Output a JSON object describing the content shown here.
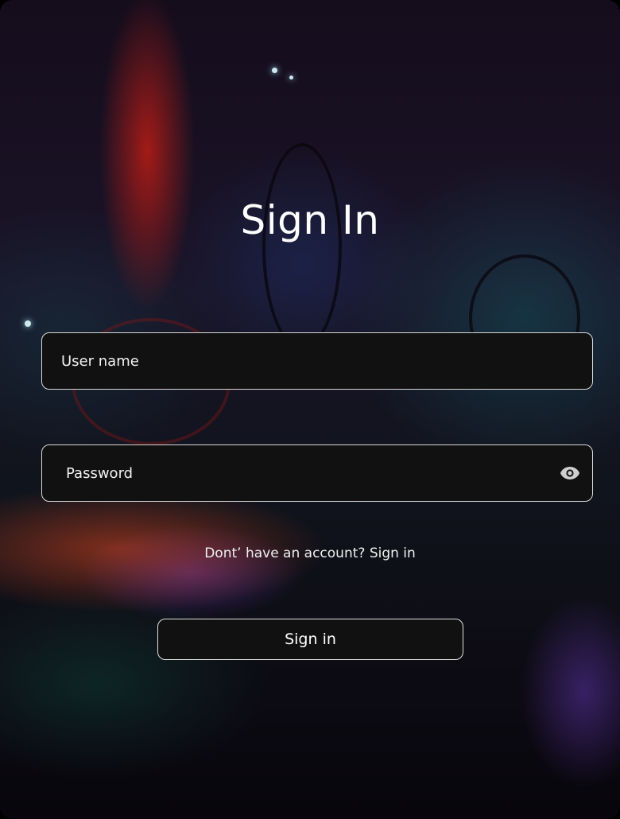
{
  "title": "Sign In",
  "username": {
    "placeholder": "User name",
    "value": ""
  },
  "password": {
    "placeholder": "Password",
    "value": ""
  },
  "password_toggle_icon": "eye-icon",
  "account_prompt": {
    "text": "Dont’ have an account?",
    "link": "Sign in"
  },
  "submit_label": "Sign in",
  "colors": {
    "field_bg": "#111112",
    "field_border": "#d9d9d9",
    "text": "#ffffff"
  }
}
